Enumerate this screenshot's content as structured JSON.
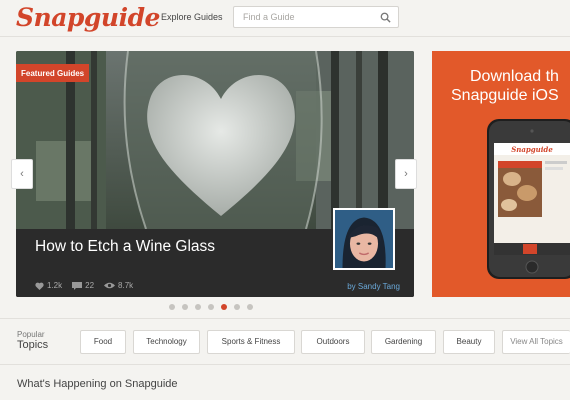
{
  "header": {
    "logo": "Snapguide",
    "explore_label": "Explore Guides",
    "search_placeholder": "Find a Guide"
  },
  "hero": {
    "tag": "Featured Guides",
    "title": "How to Etch a Wine Glass",
    "likes": "1.2k",
    "comments": "22",
    "views": "8.7k",
    "author": "by Sandy Tang",
    "prev_arrow": "‹",
    "next_arrow": "›",
    "slide_count": 7,
    "active_slide": 4
  },
  "promo": {
    "line1": "Download th",
    "line2": "Snapguide iOS"
  },
  "topics": {
    "label_small": "Popular",
    "label_big": "Topics",
    "items": [
      "Food",
      "Technology",
      "Sports & Fitness",
      "Outdoors",
      "Gardening",
      "Beauty",
      "View All Topics"
    ]
  },
  "section": {
    "happening": "What's Happening on Snapguide"
  },
  "colors": {
    "brand": "#d2452a",
    "promo_bg": "#e2592a",
    "byline": "#6aa8d8"
  }
}
